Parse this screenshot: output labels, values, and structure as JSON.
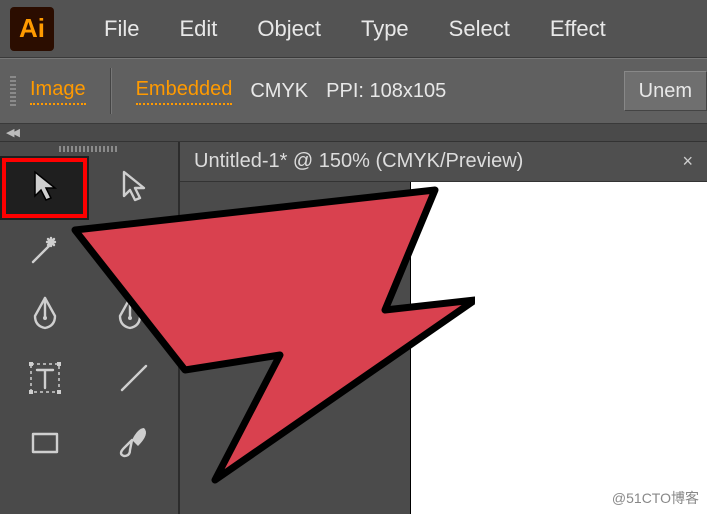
{
  "app": {
    "logo_text": "Ai"
  },
  "menubar": {
    "items": [
      "File",
      "Edit",
      "Object",
      "Type",
      "Select",
      "Effect"
    ]
  },
  "controlbar": {
    "image_label": "Image",
    "embedded_label": "Embedded",
    "color_mode": "CMYK",
    "ppi": "PPI: 108x105",
    "unembed_btn": "Unem"
  },
  "collapse": {
    "arrows": "◀◀"
  },
  "document": {
    "tab_title": "Untitled-1* @ 150% (CMYK/Preview)",
    "close_glyph": "×"
  },
  "tools": {
    "items": [
      {
        "name": "selection-tool",
        "icon": "selection",
        "highlighted": true
      },
      {
        "name": "direct-selection-tool",
        "icon": "direct-selection"
      },
      {
        "name": "magic-wand-tool",
        "icon": "magic-wand"
      },
      {
        "name": "lasso-tool",
        "icon": "lasso"
      },
      {
        "name": "pen-tool",
        "icon": "pen"
      },
      {
        "name": "add-anchor-point-tool",
        "icon": "pen-plus"
      },
      {
        "name": "type-tool",
        "icon": "type"
      },
      {
        "name": "line-segment-tool",
        "icon": "line"
      },
      {
        "name": "rectangle-tool",
        "icon": "rectangle"
      },
      {
        "name": "paintbrush-tool",
        "icon": "brush"
      }
    ]
  },
  "watermark": "@51CTO博客"
}
